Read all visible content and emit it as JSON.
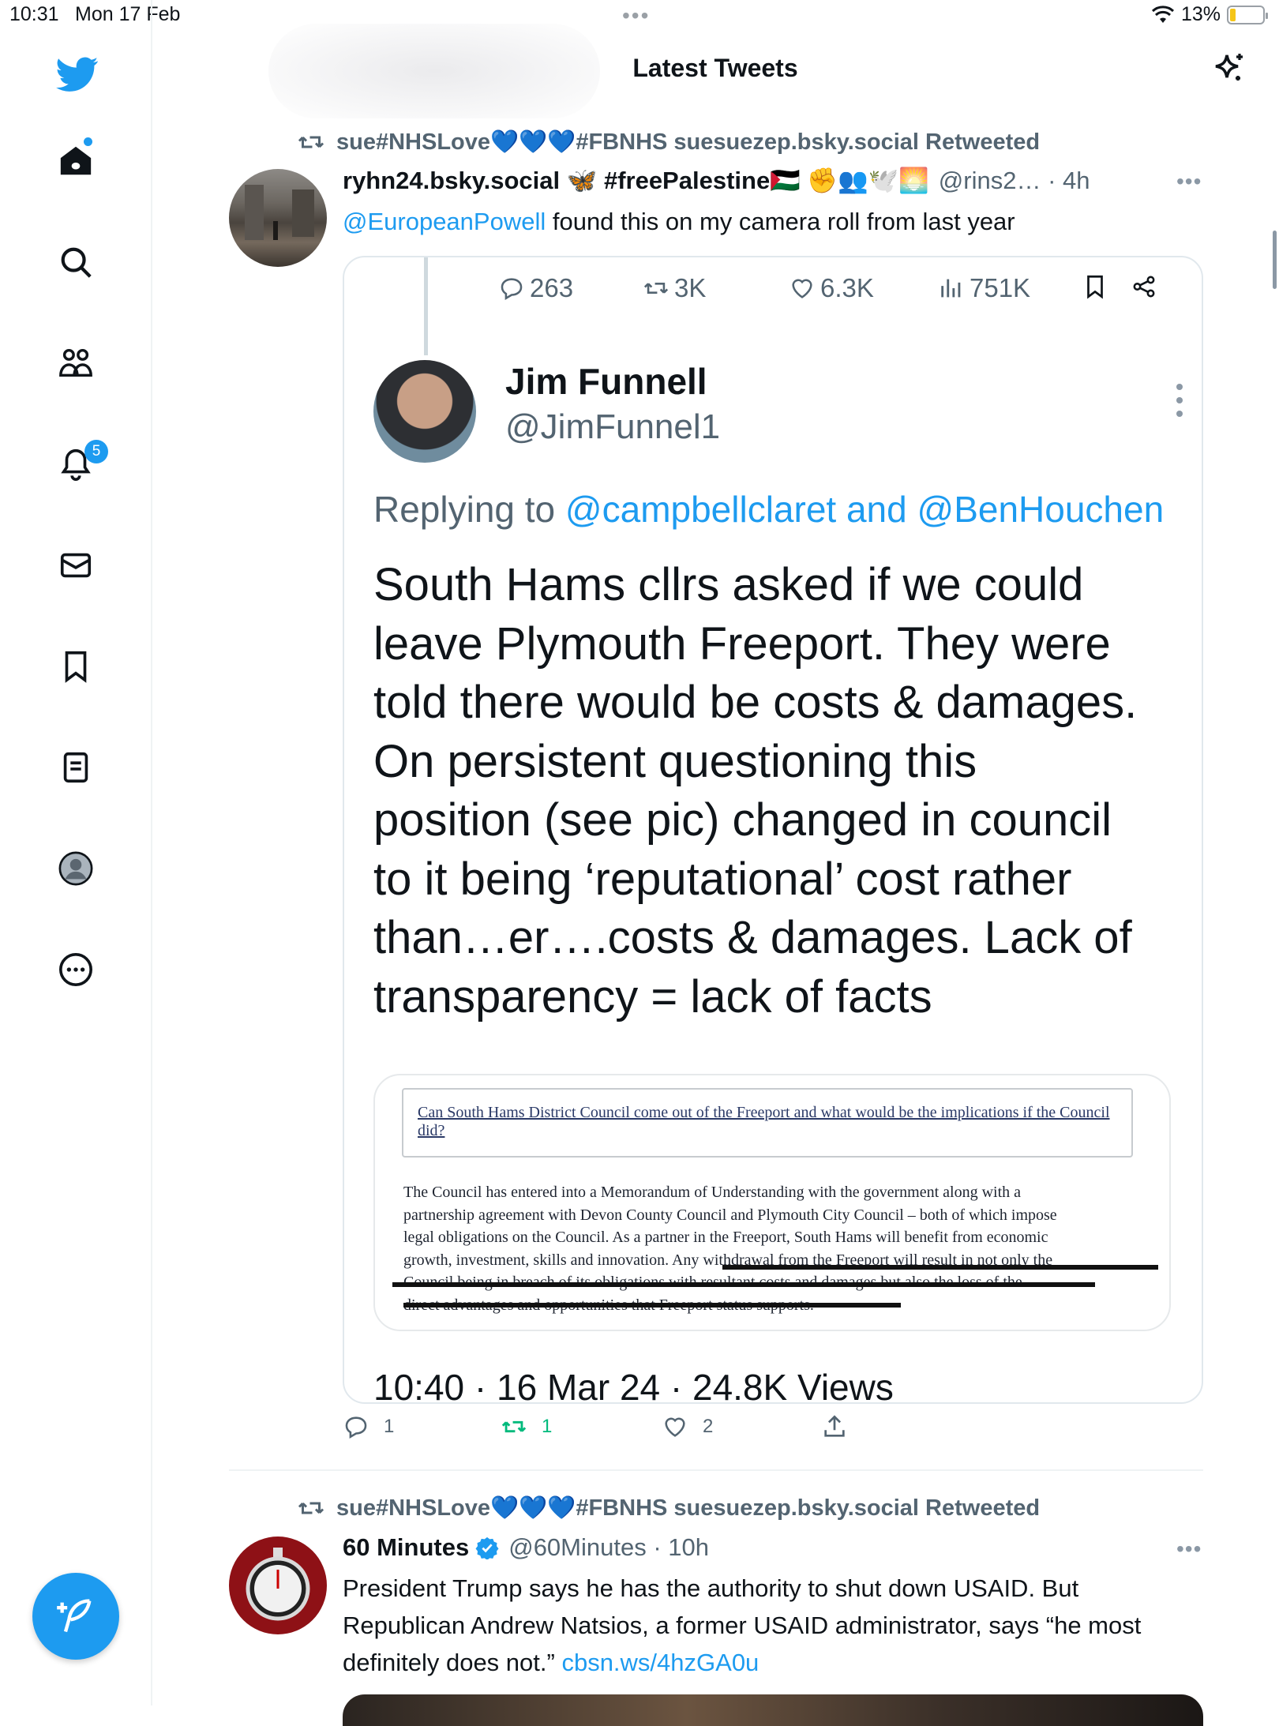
{
  "status_bar": {
    "time": "10:31",
    "date": "Mon 17 Feb",
    "battery": "13%"
  },
  "sidebar": {
    "notification_count": "5"
  },
  "header": {
    "title": "Latest Tweets"
  },
  "tweets": [
    {
      "retweeted_by": "sue#NHSLove💙💙💙#FBNHS suesuezep.bsky.social Retweeted",
      "author_name": "ryhn24.bsky.social 🦋 #freePalestine🇵🇸 ✊👥🕊️🌅",
      "handle_time": "@rins2… · 4h",
      "text_mention": "@EuropeanPowell",
      "text_rest": " found this on my camera roll from last year",
      "actions": {
        "replies": "1",
        "retweets": "1",
        "likes": "2"
      }
    },
    {
      "retweeted_by": "sue#NHSLove💙💙💙#FBNHS suesuezep.bsky.social Retweeted",
      "author_name": "60 Minutes",
      "handle_time": "@60Minutes · 10h",
      "text": "President Trump says he has the authority to shut down USAID. But Republican Andrew Natsios, a former USAID administrator, says “he most definitely does not.” ",
      "link": "cbsn.ws/4hzGA0u"
    }
  ],
  "screenshot": {
    "stats": {
      "replies": "263",
      "retweets": "3K",
      "likes": "6.3K",
      "views": "751K"
    },
    "name": "Jim Funnell",
    "handle": "@JimFunnel1",
    "replying_prefix": "Replying to ",
    "replying_targets": "@campbellclaret and @BenHouchen",
    "lines": [
      "South Hams cllrs asked if we could",
      "leave Plymouth Freeport. They were",
      "told there would be costs & damages.",
      "On persistent questioning this",
      "position (see pic) changed in council",
      "to it being ‘reputational’ cost rather",
      "than…er….costs & damages. Lack of",
      "transparency = lack of facts"
    ],
    "doc_question": "Can South Hams District Council come out of the Freeport and what would be the implications if the Council did?",
    "doc_lines": [
      "The Council has entered into a Memorandum of Understanding with the government along with a",
      "partnership agreement with Devon County Council and Plymouth City Council – both of which impose",
      "legal obligations on the Council. As a partner in the Freeport, South Hams will benefit from economic",
      "growth, investment, skills and innovation. Any withdrawal from the Freeport will result in not only the",
      "Council being in breach of its obligations with resultant costs and damages but also the loss of the",
      "direct advantages and opportunities that Freeport status supports."
    ],
    "footer_cut": "10:40 · 16 Mar 24 · 24.8K Views"
  }
}
